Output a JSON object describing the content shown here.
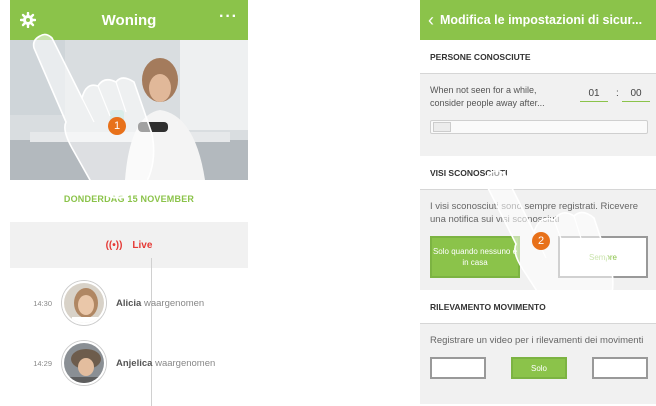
{
  "left_screen": {
    "header": {
      "title": "Woning",
      "more": "···"
    },
    "date": "DONDERDAG 15 NOVEMBER",
    "live": {
      "icon": "((•))",
      "label": "Live"
    },
    "events": [
      {
        "time": "14:30",
        "name": "Alicia",
        "action": " waargenomen"
      },
      {
        "time": "14:29",
        "name": "Anjelica",
        "action": " waargenomen"
      }
    ],
    "step": "1"
  },
  "right_screen": {
    "header": {
      "back": "‹",
      "title": "Modifica le impostazioni di sicur..."
    },
    "known_people": {
      "title": "PERSONE CONOSCIUTE",
      "text": "When not seen for a while, consider people away after...",
      "hours": "01",
      "separator": ":",
      "minutes": "00"
    },
    "unknown_faces": {
      "title": "VISI SCONOSCIUTI",
      "text": "I visi sconosciuti sono sempre registrati. Ricevere una notifica sui visi sconosciuti",
      "btn_home": "Solo quando nessuno è in casa",
      "btn_always": "Sempre"
    },
    "motion": {
      "title": "RILEVAMENTO MOVIMENTO",
      "text": "Registrare un video per i rilevamenti dei movimenti",
      "btn_middle": "Solo"
    },
    "step": "2"
  },
  "colors": {
    "accent": "#8bc34a",
    "badge": "#e8711a",
    "live": "#e53935"
  }
}
